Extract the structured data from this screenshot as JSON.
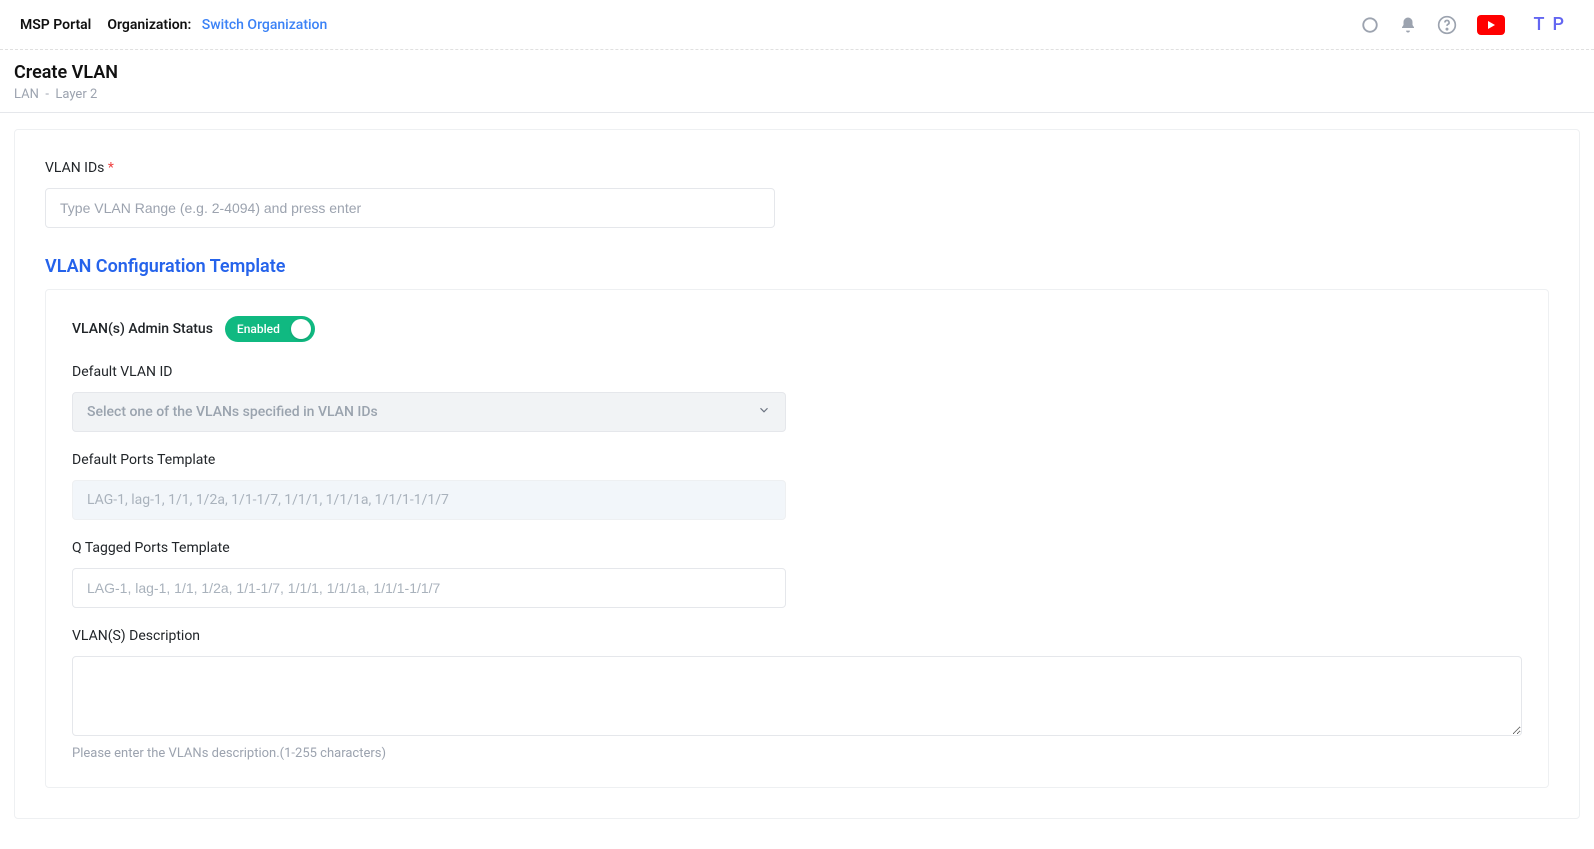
{
  "topbar": {
    "portal_name": "MSP Portal",
    "org_label": "Organization:",
    "switch_org": "Switch Organization",
    "avatar_initials": "T P"
  },
  "header": {
    "title": "Create VLAN",
    "breadcrumb_parent": "LAN",
    "breadcrumb_sep": "-",
    "breadcrumb_current": "Layer 2"
  },
  "form": {
    "vlan_ids_label": "VLAN IDs",
    "required_star": "*",
    "vlan_ids_placeholder": "Type VLAN Range (e.g. 2-4094) and press enter",
    "template_heading": "VLAN Configuration Template",
    "admin_status_label": "VLAN(s) Admin Status",
    "toggle_label": "Enabled",
    "default_vlan_id_label": "Default VLAN ID",
    "default_vlan_id_placeholder": "Select one of the VLANs specified in VLAN IDs",
    "default_ports_label": "Default Ports Template",
    "default_ports_placeholder": "LAG-1, lag-1, 1/1, 1/2a, 1/1-1/7, 1/1/1, 1/1/1a, 1/1/1-1/1/7",
    "q_tagged_label": "Q Tagged Ports Template",
    "q_tagged_placeholder": "LAG-1, lag-1, 1/1, 1/2a, 1/1-1/7, 1/1/1, 1/1/1a, 1/1/1-1/1/7",
    "description_label": "VLAN(S) Description",
    "description_helper": "Please enter the VLANs description.(1-255 characters)"
  }
}
